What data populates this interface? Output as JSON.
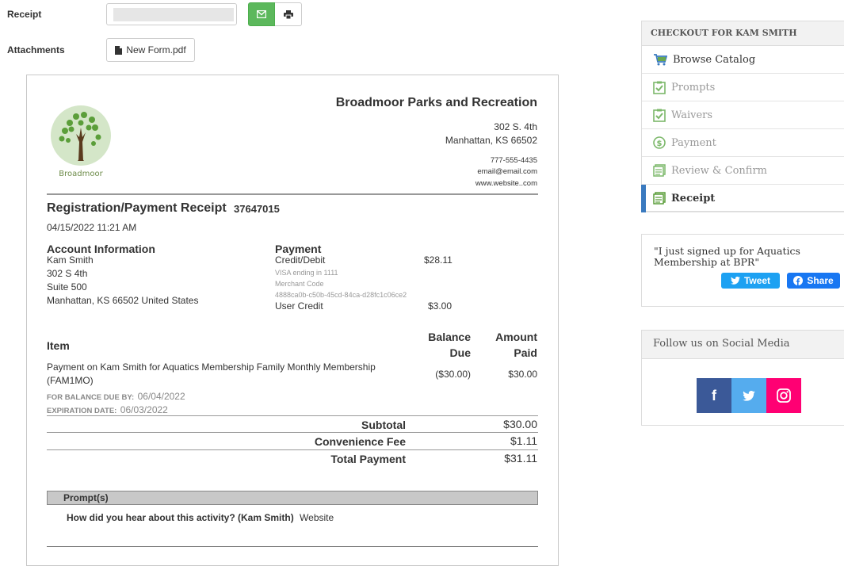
{
  "form": {
    "receipt_label": "Receipt",
    "attachments_label": "Attachments",
    "attachment_file": "New Form.pdf"
  },
  "receipt": {
    "org_name": "Broadmoor Parks and Recreation",
    "logo_text": "Broadmoor",
    "address_line1": "302 S. 4th",
    "address_line2": "Manhattan, KS 66502",
    "phone": "777-555-4435",
    "email": "email@email.com",
    "website": "www.website..com",
    "title": "Registration/Payment Receipt",
    "number": "37647015",
    "date": "04/15/2022 11:21 AM",
    "account": {
      "heading": "Account Information",
      "name": "Kam Smith",
      "street": "302 S 4th",
      "suite": "Suite 500",
      "city": "Manhattan, KS 66502 United States"
    },
    "payment": {
      "heading": "Payment",
      "method": "Credit/Debit",
      "method_amount": "$28.11",
      "card": "VISA ending in 1111",
      "merchant_label": "Merchant Code",
      "merchant_code": "4888ca0b-c50b-45cd-84ca-d28fc1c06ce2",
      "user_credit_label": "User Credit",
      "user_credit_amount": "$3.00"
    },
    "table": {
      "col_item": "Item",
      "col_balance_1": "Balance",
      "col_balance_2": "Due",
      "col_amount_1": "Amount",
      "col_amount_2": "Paid",
      "item_line1": "Payment on Kam Smith for Aquatics Membership Family Monthly Membership",
      "item_line2": "(FAM1MO)",
      "balance_due": "($30.00)",
      "amount_paid": "$30.00",
      "balance_due_by_label": "FOR BALANCE DUE BY:",
      "balance_due_by": "06/04/2022",
      "expiration_label": "EXPIRATION DATE:",
      "expiration": "06/03/2022"
    },
    "totals": {
      "subtotal_label": "Subtotal",
      "subtotal": "$30.00",
      "fee_label": "Convenience Fee",
      "fee": "$1.11",
      "total_label": "Total Payment",
      "total": "$31.11"
    },
    "prompts": {
      "heading": "Prompt(s)",
      "question": "How did you hear about this activity? (Kam Smith)",
      "answer": "Website"
    }
  },
  "checkout": {
    "heading": "CHECKOUT FOR KAM SMITH",
    "steps": [
      {
        "label": "Browse Catalog",
        "icon": "cart-icon"
      },
      {
        "label": "Prompts",
        "icon": "clipboard-check-icon"
      },
      {
        "label": "Waivers",
        "icon": "clipboard-check-icon"
      },
      {
        "label": "Payment",
        "icon": "dollar-circle-icon"
      },
      {
        "label": "Review & Confirm",
        "icon": "receipt-icon"
      },
      {
        "label": "Receipt",
        "icon": "receipt-icon"
      }
    ],
    "active_step": "Receipt"
  },
  "share": {
    "quote": "\"I just signed up for Aquatics Membership at BPR\"",
    "tweet_label": "Tweet",
    "share_label": "Share"
  },
  "social": {
    "heading": "Follow us on Social Media",
    "facebook_color": "#3b5998",
    "twitter_color": "#55acee",
    "instagram_color": "#ff0073"
  },
  "colors": {
    "email_button": "#5cb85c",
    "active_step_bar": "#3a7abf",
    "tweet_button": "#1da1f2",
    "share_button": "#1877f2"
  }
}
